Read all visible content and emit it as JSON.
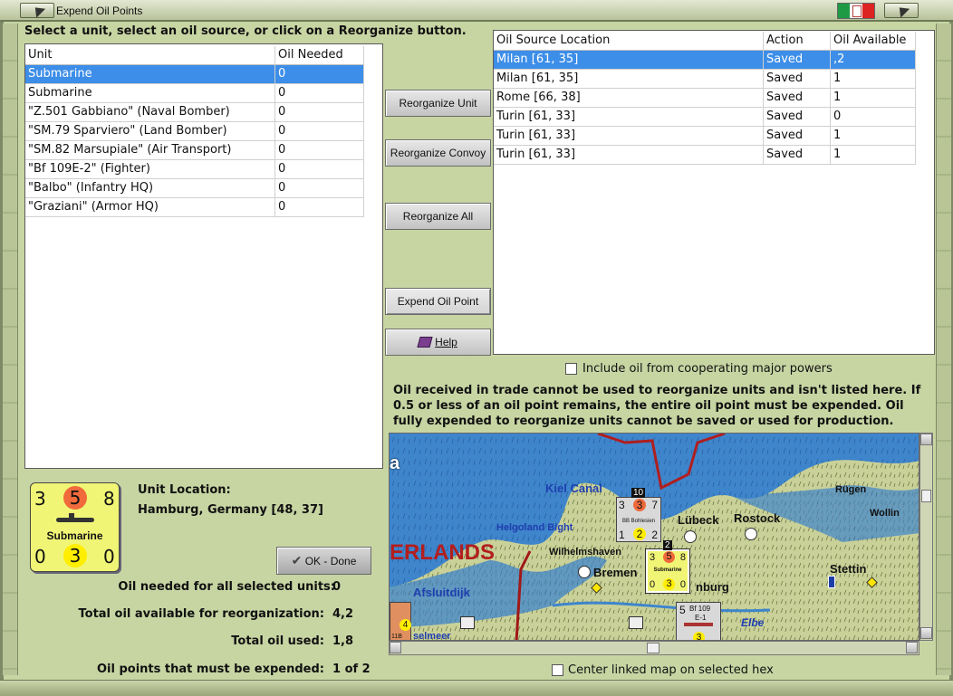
{
  "window": {
    "title": "Expend Oil Points"
  },
  "instructions": "Select a unit, select an oil source, or click on a Reorganize button.",
  "unit_table": {
    "headers": [
      "Unit",
      "Oil Needed"
    ],
    "rows": [
      [
        "Submarine",
        "0"
      ],
      [
        "Submarine",
        "0"
      ],
      [
        "\"Z.501 Gabbiano\" (Naval Bomber)",
        "0"
      ],
      [
        "\"SM.79 Sparviero\" (Land Bomber)",
        "0"
      ],
      [
        "\"SM.82 Marsupiale\" (Air Transport)",
        "0"
      ],
      [
        "\"Bf 109E-2\" (Fighter)",
        "0"
      ],
      [
        "\"Balbo\" (Infantry HQ)",
        "0"
      ],
      [
        "\"Graziani\" (Armor HQ)",
        "0"
      ]
    ]
  },
  "buttons": {
    "reorganize_unit": "Reorganize Unit",
    "reorganize_convoy": "Reorganize Convoy",
    "reorganize_all": "Reorganize All",
    "expend_oil_point": "Expend Oil Point",
    "help": "Help",
    "ok_done": "OK - Done"
  },
  "oil_table": {
    "headers": [
      "Oil Source Location",
      "Action",
      "Oil Available"
    ],
    "rows": [
      [
        "Milan [61, 35]",
        "Saved",
        ",2"
      ],
      [
        "Milan [61, 35]",
        "Saved",
        "1"
      ],
      [
        "Rome [66, 38]",
        "Saved",
        "1"
      ],
      [
        "Turin [61, 33]",
        "Saved",
        "0"
      ],
      [
        "Turin [61, 33]",
        "Saved",
        "1"
      ],
      [
        "Turin [61, 33]",
        "Saved",
        "1"
      ]
    ]
  },
  "include_oil_label": "Include oil from cooperating major powers",
  "note": [
    "Oil received in trade cannot be used to reorganize units and isn't listed here.  If",
    "0.5 or less of an oil point remains, the entire oil point must be expended.   Oil",
    "fully expended to reorganize units cannot be saved or used for production."
  ],
  "unit_counter": {
    "top_left": "3",
    "top_mid": "5",
    "top_right": "8",
    "name": "Submarine",
    "bottom_left": "0",
    "bottom_mid": "3",
    "bottom_right": "0"
  },
  "unit_location": {
    "label": "Unit Location:",
    "value": "Hamburg, Germany [48, 37]"
  },
  "stats": [
    {
      "label": "Oil needed for all selected units:",
      "value": "0"
    },
    {
      "label": "Total oil available for reorganization:",
      "value": "4,2"
    },
    {
      "label": "Total oil used:",
      "value": "1,8"
    },
    {
      "label": "Oil points that must be expended:",
      "value": "1 of 2"
    }
  ],
  "map": {
    "labels": {
      "kiel": "Kiel Canal",
      "helgoland": "Helgoland Bight",
      "wilhelmshaven": "Wilhelmshaven",
      "bremen": "Bremen",
      "lubeck": "Lübeck",
      "rostock": "Rostock",
      "rugen": "Rügen",
      "wollin": "Wollin",
      "stettin": "Stettin",
      "afsluitdijk": "Afsluitdijk",
      "elbe": "Elbe",
      "nederlands": "ERLANDS",
      "hamburg": "nburg",
      "a": "a",
      "ijsselmeer": "selmeer"
    },
    "counters": {
      "bohlesien": {
        "top": "3",
        "mid": "3",
        "right": "7",
        "name": "BB Bohlesien",
        "b1": "1",
        "b2": "2",
        "b3": "2",
        "stack": "10"
      },
      "sub": {
        "top": "3",
        "mid": "5",
        "right": "8",
        "name": "Submarine",
        "b1": "0",
        "b2": "3",
        "b3": "0",
        "stack": "2"
      },
      "bf109": {
        "top": "5",
        "name": "Bf 109",
        "sub": "E-1",
        "b2": "3"
      },
      "left": {
        "num": "4",
        "code": "11B"
      }
    }
  },
  "center_map_label": "Center linked map on selected hex",
  "colors": {
    "selection": "#3d8ee8",
    "background": "#c7d5a3",
    "counter": "#f1f576",
    "sea": "#3f86cf",
    "border": "#b01e1e"
  }
}
